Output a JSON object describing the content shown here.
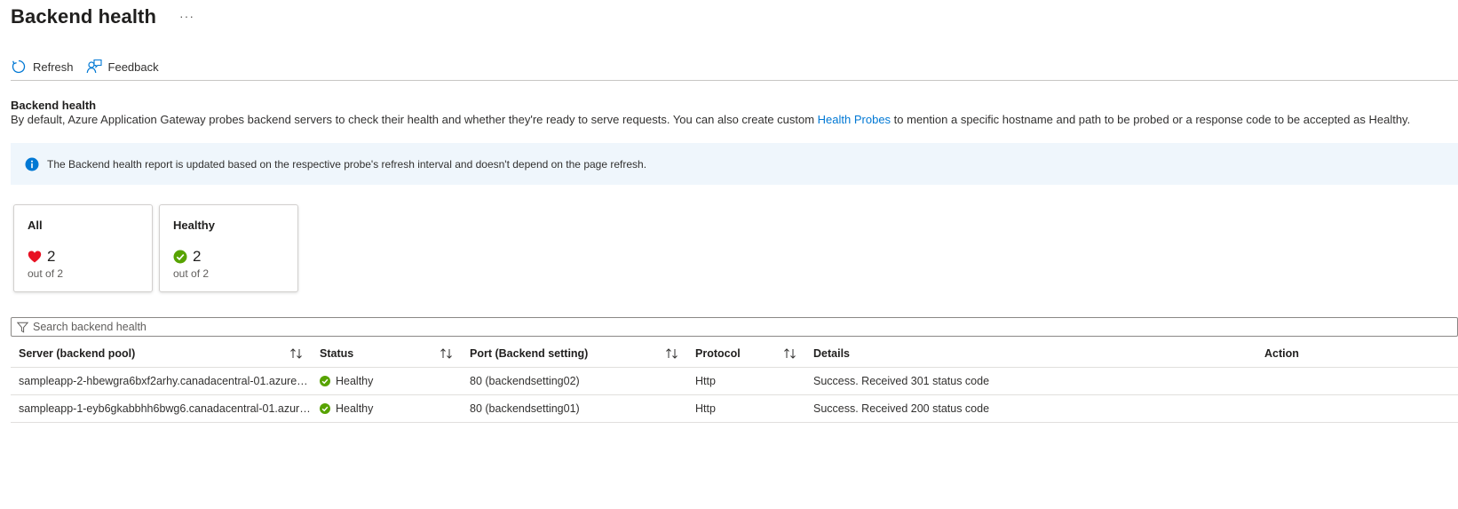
{
  "page": {
    "title": "Backend health",
    "more_label": "···"
  },
  "toolbar": {
    "refresh_label": "Refresh",
    "feedback_label": "Feedback"
  },
  "section": {
    "title": "Backend health",
    "desc_before": "By default, Azure Application Gateway probes backend servers to check their health and whether they're ready to serve requests. You can also create custom ",
    "desc_link": "Health Probes",
    "desc_after": " to mention a specific hostname and path to be probed or a response code to be accepted as Healthy."
  },
  "banner": {
    "text": "The Backend health report is updated based on the respective probe's refresh interval and doesn't depend on the page refresh."
  },
  "cards": [
    {
      "title": "All",
      "icon": "heart-icon",
      "count": "2",
      "sub": "out of 2"
    },
    {
      "title": "Healthy",
      "icon": "check-circle-icon",
      "count": "2",
      "sub": "out of 2"
    }
  ],
  "search": {
    "placeholder": "Search backend health",
    "value": ""
  },
  "table": {
    "columns": [
      {
        "label": "Server (backend pool)",
        "sortable": true
      },
      {
        "label": "Status",
        "sortable": true
      },
      {
        "label": "Port (Backend setting)",
        "sortable": true
      },
      {
        "label": "Protocol",
        "sortable": true
      },
      {
        "label": "Details",
        "sortable": false
      },
      {
        "label": "Action",
        "sortable": false
      }
    ],
    "rows": [
      {
        "server": "sampleapp-2-hbewgra6bxf2arhy.canadacentral-01.azurew...",
        "status": "Healthy",
        "port": "80 (backendsetting02)",
        "protocol": "Http",
        "details": "Success. Received 301 status code",
        "action": ""
      },
      {
        "server": "sampleapp-1-eyb6gkabbhh6bwg6.canadacentral-01.azure...",
        "status": "Healthy",
        "port": "80 (backendsetting01)",
        "protocol": "Http",
        "details": "Success. Received 200 status code",
        "action": ""
      }
    ]
  },
  "colors": {
    "accent": "#0078d4",
    "healthy": "#57a300",
    "heart": "#e81123",
    "banner_bg": "#eff6fc"
  }
}
